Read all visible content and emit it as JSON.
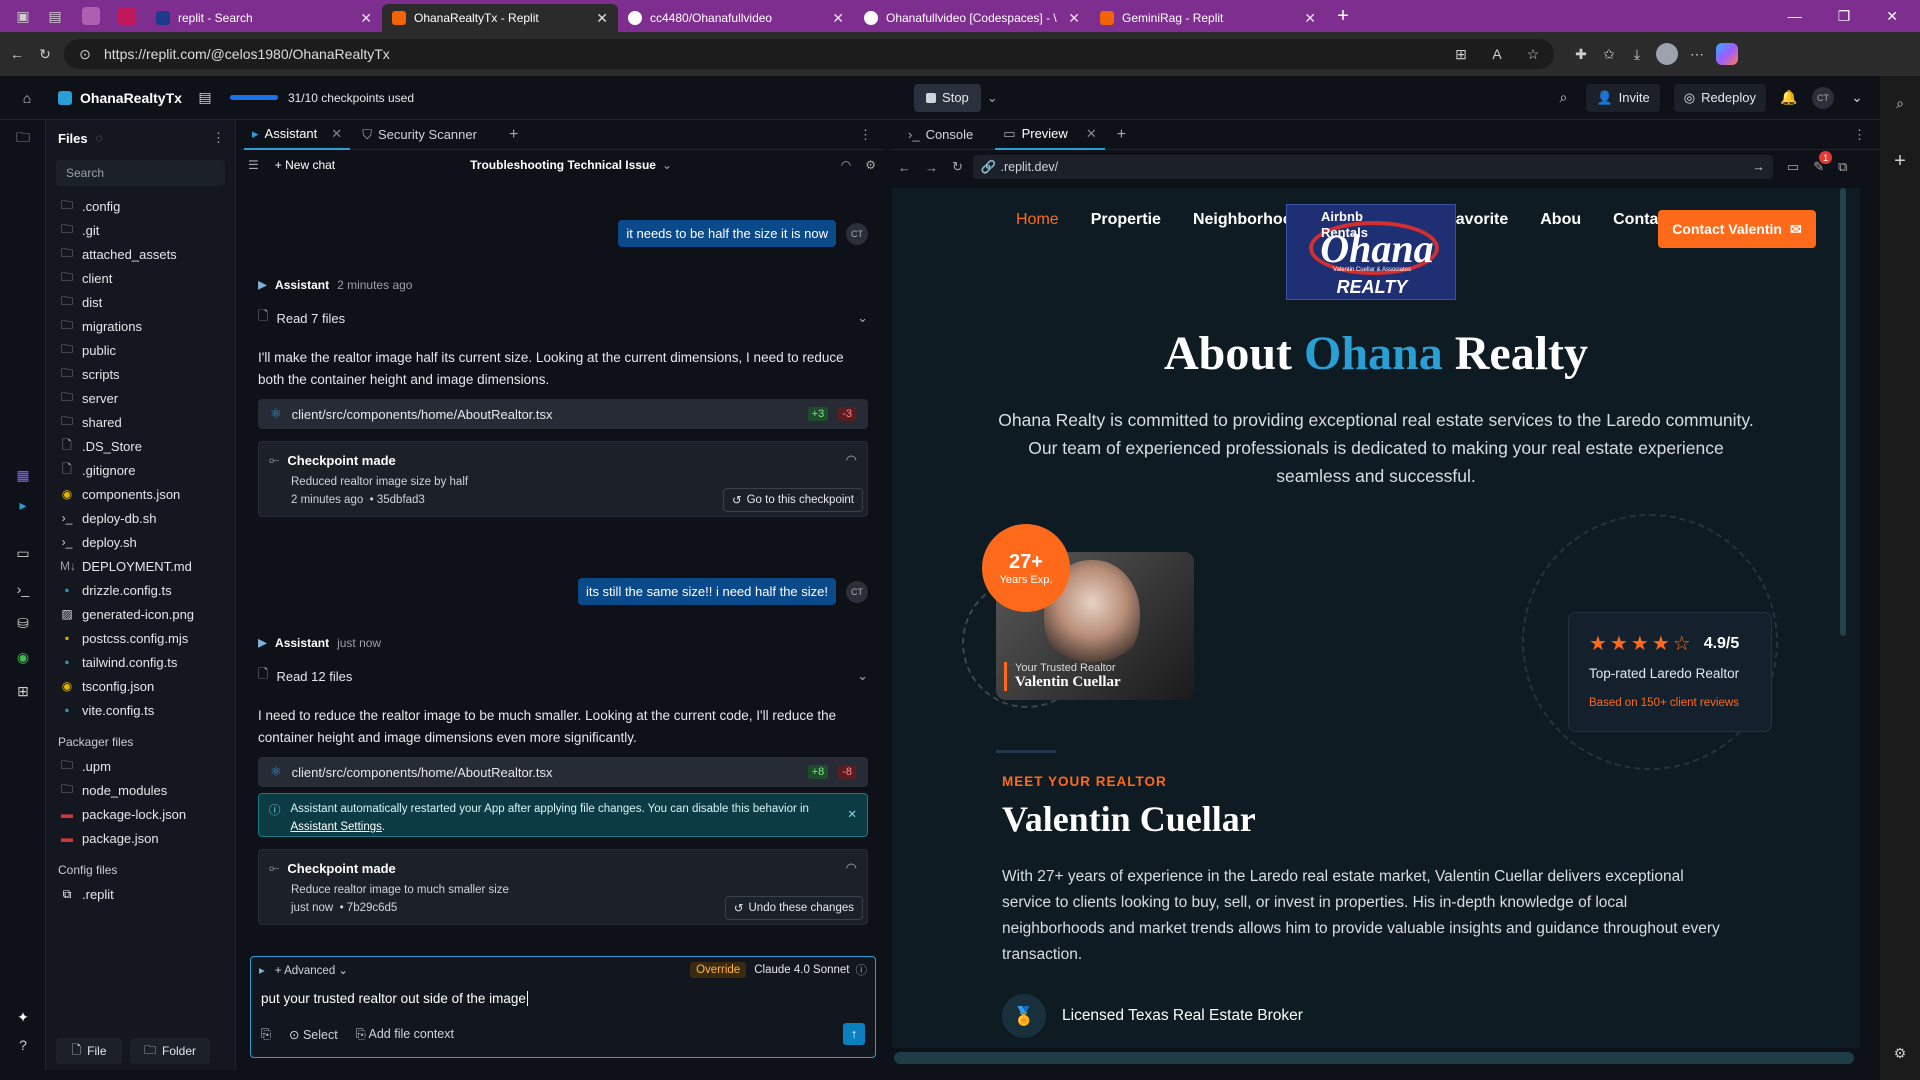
{
  "browser": {
    "tabs": [
      {
        "title": "replit - Search",
        "color": "#c2185b"
      },
      {
        "title": "OhanaRealtyTx - Replit",
        "color": "#f26207"
      },
      {
        "title": "cc4480/Ohanafullvideo",
        "color": "#ffffff"
      },
      {
        "title": "Ohanafullvideo [Codespaces] - \\",
        "color": "#ffffff"
      },
      {
        "title": "GeminiRag - Replit",
        "color": "#f26207"
      }
    ],
    "url": "https://replit.com/@celos1980/OhanaRealtyTx",
    "url_host": "replit.com",
    "accent": "#7e2e8f"
  },
  "replit": {
    "project": "OhanaRealtyTx",
    "checkpoints": "31/10 checkpoints used",
    "checkpoint_progress": 1.0,
    "stop_label": "Stop",
    "invite_label": "Invite",
    "redeploy_label": "Redeploy",
    "avatar": "CT"
  },
  "files": {
    "title": "Files",
    "search_placeholder": "Search",
    "items": [
      {
        "name": ".config",
        "type": "folder"
      },
      {
        "name": ".git",
        "type": "folder"
      },
      {
        "name": "attached_assets",
        "type": "folder"
      },
      {
        "name": "client",
        "type": "folder"
      },
      {
        "name": "dist",
        "type": "folder"
      },
      {
        "name": "migrations",
        "type": "folder"
      },
      {
        "name": "public",
        "type": "folder"
      },
      {
        "name": "scripts",
        "type": "folder"
      },
      {
        "name": "server",
        "type": "folder"
      },
      {
        "name": "shared",
        "type": "folder"
      },
      {
        "name": ".DS_Store",
        "type": "file"
      },
      {
        "name": ".gitignore",
        "type": "file"
      },
      {
        "name": "components.json",
        "type": "json"
      },
      {
        "name": "deploy-db.sh",
        "type": "shell"
      },
      {
        "name": "deploy.sh",
        "type": "shell"
      },
      {
        "name": "DEPLOYMENT.md",
        "type": "md"
      },
      {
        "name": "drizzle.config.ts",
        "type": "ts"
      },
      {
        "name": "generated-icon.png",
        "type": "image"
      },
      {
        "name": "postcss.config.mjs",
        "type": "js"
      },
      {
        "name": "tailwind.config.ts",
        "type": "ts"
      },
      {
        "name": "tsconfig.json",
        "type": "json"
      },
      {
        "name": "vite.config.ts",
        "type": "ts"
      }
    ],
    "packager_title": "Packager files",
    "packager": [
      {
        "name": ".upm",
        "type": "folder"
      },
      {
        "name": "node_modules",
        "type": "folder"
      },
      {
        "name": "package-lock.json",
        "type": "npm"
      },
      {
        "name": "package.json",
        "type": "npm"
      }
    ],
    "config_title": "Config files",
    "config": [
      {
        "name": ".replit",
        "type": "replit"
      }
    ],
    "file_button": "File",
    "folder_button": "Folder"
  },
  "assistant": {
    "tab_label": "Assistant",
    "tab2_label": "Security Scanner",
    "new_chat": "New chat",
    "chat_title": "Troubleshooting Technical Issue",
    "messages": [
      {
        "user": "it needs to be half the size it is now"
      },
      {
        "name": "Assistant",
        "time": "2 minutes ago",
        "read": "Read 7 files",
        "text": "I'll make the realtor image half its current size. Looking at the current dimensions, I need to reduce both the container height and image dimensions.",
        "file": "client/src/components/home/AboutRealtor.tsx",
        "plus": "+3",
        "minus": "-3",
        "checkpoint_title": "Checkpoint made",
        "checkpoint_desc": "Reduced realtor image size by half",
        "checkpoint_time": "2 minutes ago",
        "checkpoint_hash": "• 35dbfad3",
        "checkpoint_button": "Go to this checkpoint"
      },
      {
        "user": "its still the same size!! i need half the size!"
      },
      {
        "name": "Assistant",
        "time": "just now",
        "read": "Read 12 files",
        "text": "I need to reduce the realtor image to be much smaller. Looking at the current code, I'll reduce the container height and image dimensions even more significantly.",
        "file": "client/src/components/home/AboutRealtor.tsx",
        "plus": "+8",
        "minus": "-8",
        "notice": "Assistant automatically restarted your App after applying file changes. You can disable this behavior in",
        "notice_link": "Assistant Settings",
        "checkpoint_title": "Checkpoint made",
        "checkpoint_desc": "Reduce realtor image to much smaller size",
        "checkpoint_time": "just now",
        "checkpoint_hash": "• 7b29c6d5",
        "checkpoint_button": "Undo these changes"
      }
    ],
    "composer": {
      "advanced": "Advanced",
      "override": "Override",
      "model": "Claude 4.0 Sonnet",
      "input_value": "put your trusted realtor out side of the image",
      "select": "Select",
      "add_context": "Add file context"
    }
  },
  "preview": {
    "console_tab": "Console",
    "preview_tab": "Preview",
    "url": ".replit.dev/",
    "badge_count": "1",
    "site": {
      "nav": [
        "Home",
        "Propertie",
        "Neighborhooc",
        "Favorite",
        "Abou",
        "Contac"
      ],
      "contact_button": "Contact Valentin",
      "logo_line1": "Airbnb",
      "logo_line2": "Rentals",
      "logo_brand": "Ohana",
      "logo_sub": "Valentin Cuellar & Associates",
      "logo_realty": "REALTY",
      "heading_a": "About",
      "heading_b": "Ohana",
      "heading_c": "Realty",
      "intro": "Ohana Realty is committed to providing exceptional real estate services to the Laredo community. Our team of experienced professionals is dedicated to making your real estate experience seamless and successful.",
      "badge_num": "27+",
      "badge_label": "Years Exp.",
      "trusted": "Your Trusted Realtor",
      "realtor_name": "Valentin Cuellar",
      "rating": "4.9/5",
      "rating_stars": 4,
      "rating_label": "Top-rated Laredo Realtor",
      "rating_note": "Based on 150+ client reviews",
      "meet": "MEET YOUR REALTOR",
      "name_heading": "Valentin Cuellar",
      "bio": "With 27+ years of experience in the Laredo real estate market, Valentin Cuellar delivers exceptional service to clients looking to buy, sell, or invest in properties. His in-depth knowledge of local neighborhoods and market trends allows him to provide valuable insights and guidance throughout every transaction.",
      "license": "Licensed Texas Real Estate Broker",
      "accent": "#ff6a1a",
      "blue": "#2a9fd6"
    }
  }
}
